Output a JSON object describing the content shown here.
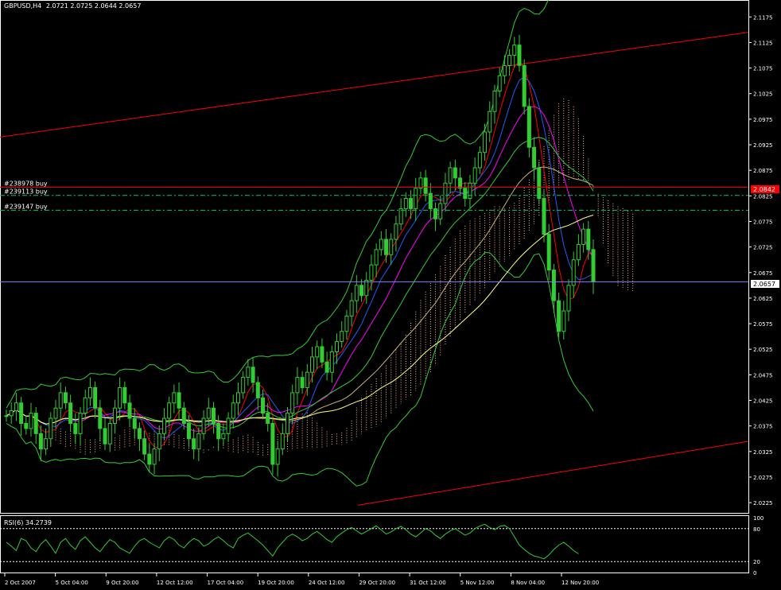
{
  "header": {
    "symbol_timeframe": "GBPUSD,H4",
    "ohlc": "2.0721 2.0725 2.0644 2.0657"
  },
  "colors": {
    "background": "#000000",
    "bull_candle": "#32cd32",
    "bear_candle": "#32cd32",
    "bollinger": "#32cd32",
    "channel": "#ff0000",
    "cloud": "#ffb58a",
    "ma_blue": "#1e5bff",
    "ma_magenta": "#ff00ff",
    "ma_red": "#ff0000",
    "ma_yellow": "#ffff80",
    "ma_olive": "#c8b46e",
    "order_line": "#00cc66",
    "bid_line": "#8080ff",
    "grid_frame": "#ffffff"
  },
  "orders": [
    {
      "label": "#238978 buy",
      "price": 2.0842
    },
    {
      "label": "#239113 buy",
      "price": 2.0826
    },
    {
      "label": "#239147 buy",
      "price": 2.0797
    }
  ],
  "price_tags": {
    "red_tag": "2.0842",
    "current_tag": "2.0657"
  },
  "indicator": {
    "label": "RSI(6) 34.2739",
    "levels": [
      "100",
      "80",
      "20",
      "0"
    ]
  },
  "chart_data": {
    "type": "candlestick",
    "title": "GBPUSD,H4",
    "y_axis_ticks": [
      "2.1175",
      "2.1125",
      "2.1075",
      "2.1025",
      "2.0975",
      "2.0925",
      "2.0875",
      "2.0825",
      "2.0775",
      "2.0725",
      "2.0675",
      "2.0625",
      "2.0575",
      "2.0525",
      "2.0475",
      "2.0425",
      "2.0375",
      "2.0325",
      "2.0275",
      "2.0225"
    ],
    "x_axis_ticks": [
      "2 Oct 2007",
      "5 Oct 04:00",
      "9 Oct 20:00",
      "12 Oct 12:00",
      "17 Oct 04:00",
      "19 Oct 20:00",
      "24 Oct 12:00",
      "29 Oct 20:00",
      "31 Oct 12:00",
      "5 Nov 12:00",
      "8 Nov 04:00",
      "12 Nov 20:00"
    ],
    "ylim": [
      2.0205,
      2.1205
    ],
    "close": [
      2.0395,
      2.0405,
      2.042,
      2.038,
      2.037,
      2.04,
      2.036,
      2.033,
      2.035,
      2.039,
      2.041,
      2.044,
      2.042,
      2.038,
      2.036,
      2.04,
      2.043,
      2.045,
      2.041,
      2.037,
      2.034,
      2.038,
      2.041,
      2.045,
      2.042,
      2.039,
      2.037,
      2.035,
      2.032,
      2.03,
      2.033,
      2.036,
      2.039,
      2.042,
      2.044,
      2.041,
      2.038,
      2.035,
      2.033,
      2.036,
      2.039,
      2.041,
      2.038,
      2.035,
      2.036,
      2.039,
      2.042,
      2.044,
      2.047,
      2.049,
      2.046,
      2.043,
      2.04,
      2.038,
      2.03,
      2.033,
      2.036,
      2.04,
      2.044,
      2.047,
      2.045,
      2.048,
      2.051,
      2.053,
      2.05,
      2.048,
      2.052,
      2.054,
      2.056,
      2.059,
      2.062,
      2.065,
      2.063,
      2.066,
      2.069,
      2.072,
      2.074,
      2.071,
      2.074,
      2.077,
      2.08,
      2.082,
      2.08,
      2.084,
      2.086,
      2.083,
      2.08,
      2.078,
      2.081,
      2.085,
      2.088,
      2.086,
      2.084,
      2.082,
      2.085,
      2.088,
      2.091,
      2.095,
      2.099,
      2.103,
      2.106,
      2.108,
      2.11,
      2.112,
      2.108,
      2.1,
      2.092,
      2.088,
      2.082,
      2.075,
      2.068,
      2.062,
      2.056,
      2.06,
      2.065,
      2.07,
      2.073,
      2.076,
      2.072,
      2.0657
    ],
    "series": [
      {
        "name": "Bollinger Bands",
        "type": "band"
      },
      {
        "name": "Ichimoku Kumo",
        "type": "cloud"
      },
      {
        "name": "Moving Averages",
        "type": "line"
      }
    ],
    "channel_lines": [
      {
        "from": [
          "2 Oct 2007",
          2.094
        ],
        "to": [
          "end",
          2.1145
        ]
      },
      {
        "from": [
          "29 Oct 20:00",
          2.022
        ],
        "to": [
          "end",
          2.0345
        ]
      }
    ],
    "rsi": {
      "period": 6,
      "last": 34.2739,
      "levels": [
        100,
        80,
        20,
        0
      ],
      "values": [
        55,
        48,
        40,
        62,
        58,
        45,
        38,
        52,
        60,
        48,
        35,
        55,
        62,
        50,
        42,
        58,
        65,
        55,
        45,
        38,
        50,
        60,
        55,
        45,
        40,
        35,
        48,
        58,
        62,
        55,
        50,
        45,
        58,
        65,
        60,
        50,
        45,
        55,
        62,
        58,
        48,
        52,
        60,
        65,
        58,
        50,
        45,
        62,
        68,
        72,
        65,
        58,
        50,
        40,
        30,
        45,
        55,
        65,
        70,
        65,
        58,
        62,
        70,
        75,
        68,
        60,
        55,
        65,
        72,
        78,
        82,
        76,
        70,
        75,
        80,
        85,
        78,
        70,
        74,
        80,
        84,
        78,
        70,
        65,
        72,
        80,
        76,
        68,
        62,
        70,
        76,
        80,
        74,
        68,
        72,
        80,
        85,
        88,
        82,
        78,
        84,
        86,
        80,
        65,
        50,
        42,
        35,
        30,
        28,
        25,
        32,
        42,
        50,
        55,
        48,
        40,
        34
      ]
    }
  }
}
